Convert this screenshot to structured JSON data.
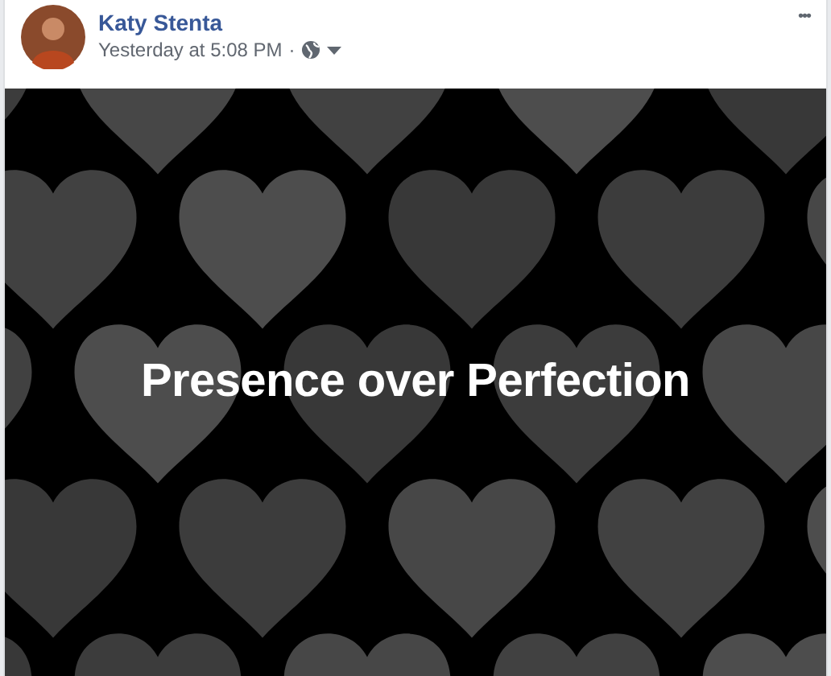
{
  "post": {
    "author": "Katy Stenta",
    "timestamp": "Yesterday at 5:08 PM",
    "separator": "·",
    "menu": "•••",
    "text": "Presence over Perfection"
  }
}
